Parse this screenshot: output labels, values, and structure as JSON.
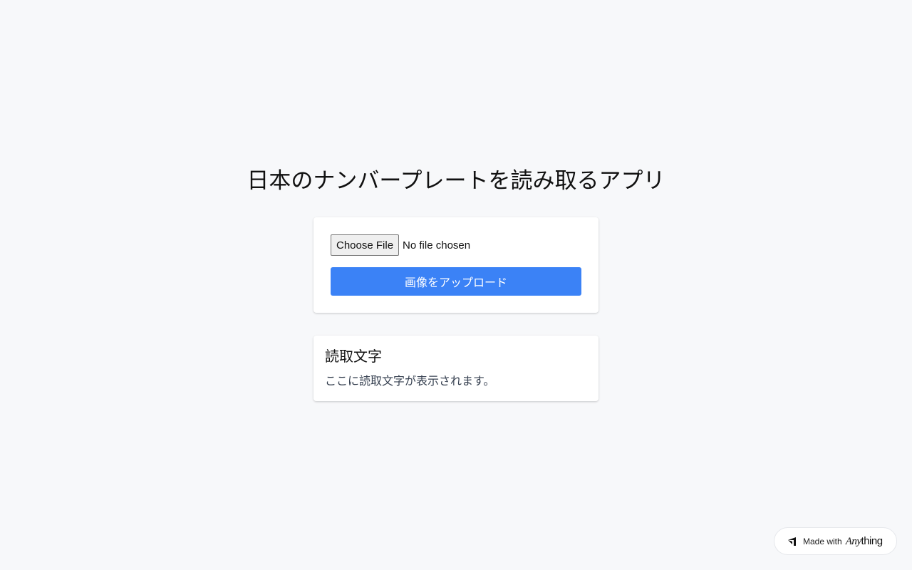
{
  "page": {
    "title": "日本のナンバープレートを読み取るアプリ"
  },
  "upload": {
    "choose_file_label": "Choose File",
    "file_status": "No file chosen",
    "upload_button_label": "画像をアップロード"
  },
  "result": {
    "heading": "読取文字",
    "placeholder_text": "ここに読取文字が表示されます。"
  },
  "badge": {
    "made_with": "Made with",
    "brand_prefix": "Any",
    "brand_suffix": "thing",
    "icon": "anything-logo-icon"
  },
  "colors": {
    "background": "#f7f8fa",
    "primary_button": "#3b82f6",
    "card": "#ffffff"
  }
}
